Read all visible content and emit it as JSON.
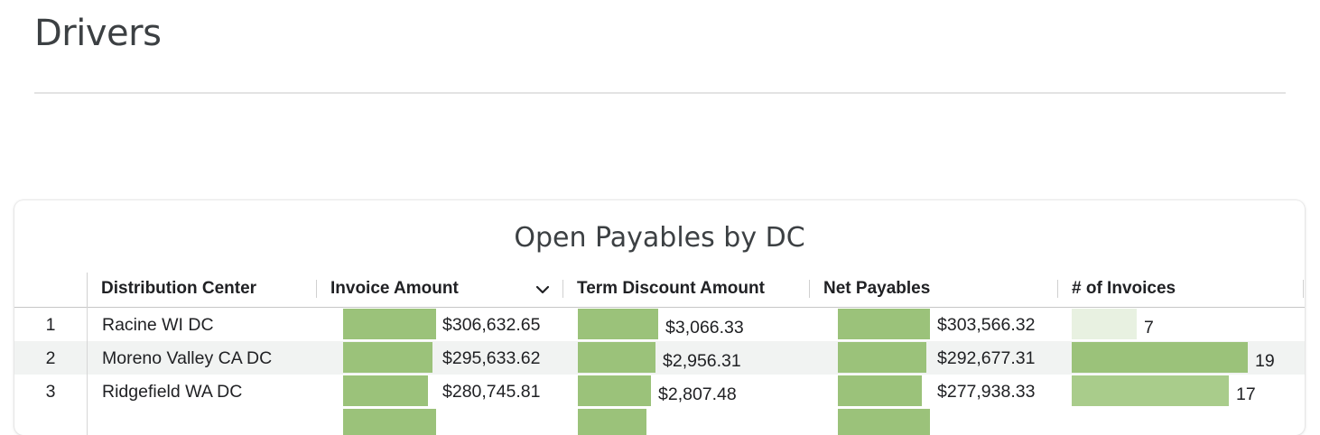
{
  "page": {
    "title": "Drivers"
  },
  "card": {
    "title": "Open Payables by DC",
    "columns": {
      "dc": "Distribution Center",
      "invoice": "Invoice Amount",
      "discount": "Term Discount Amount",
      "net": "Net Payables",
      "count": "# of Invoices"
    },
    "sort": {
      "column": "invoice",
      "direction": "descending",
      "icon": "chevron-down-icon"
    },
    "rows": [
      {
        "num": "1",
        "dc": "Racine WI DC",
        "invoice": "$306,632.65",
        "discount": "$3,066.33",
        "net": "$303,566.32",
        "count": "7",
        "invoice_value": 306632.65,
        "discount_value": 3066.33,
        "net_value": 303566.32,
        "count_value": 7
      },
      {
        "num": "2",
        "dc": "Moreno Valley CA DC",
        "invoice": "$295,633.62",
        "discount": "$2,956.31",
        "net": "$292,677.31",
        "count": "19",
        "invoice_value": 295633.62,
        "discount_value": 2956.31,
        "net_value": 292677.31,
        "count_value": 19
      },
      {
        "num": "3",
        "dc": "Ridgefield WA DC",
        "invoice": "$280,745.81",
        "discount": "$2,807.48",
        "net": "$277,938.33",
        "count": "17",
        "invoice_value": 280745.81,
        "discount_value": 2807.48,
        "net_value": 277938.33,
        "count_value": 17
      }
    ],
    "colors": {
      "bar": "#9bc27a",
      "bar_light": "#e8f1e1",
      "alt_row": "#f1f3f2"
    }
  }
}
